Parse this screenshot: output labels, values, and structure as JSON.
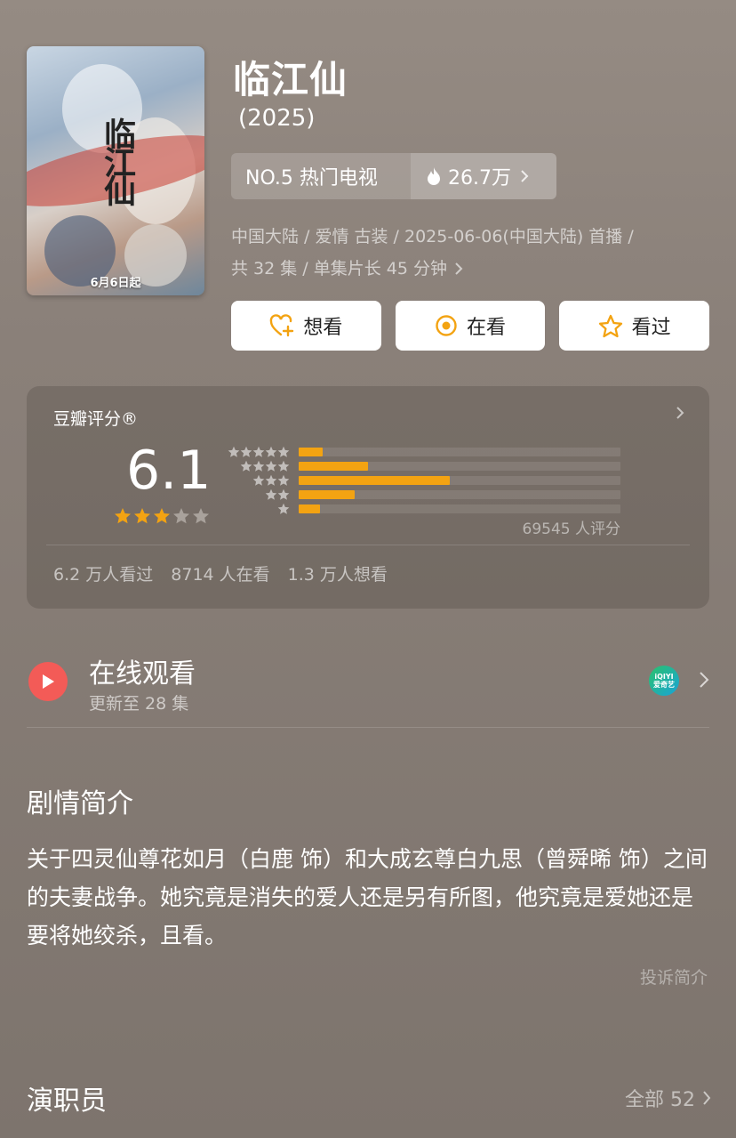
{
  "poster": {
    "title_art": "临江仙",
    "date_text": "6月6日起"
  },
  "show": {
    "title": "临江仙",
    "year": "(2025)"
  },
  "rank": {
    "label": "NO.5 热门电视",
    "heat": "26.7万"
  },
  "meta": {
    "line1": "中国大陆 / 爱情 古装 / 2025-06-06(中国大陆) 首播 /",
    "line2": "共 32 集 / 单集片长 45 分钟"
  },
  "actions": [
    {
      "label": "想看",
      "icon": "heart-plus-icon"
    },
    {
      "label": "在看",
      "icon": "target-icon"
    },
    {
      "label": "看过",
      "icon": "star-outline-icon"
    }
  ],
  "rating": {
    "label": "豆瓣评分®",
    "score": "6.1",
    "stars_filled": 3,
    "stars_total": 5,
    "distribution": [
      {
        "stars": 5,
        "percent": 7.5
      },
      {
        "stars": 4,
        "percent": 21.5
      },
      {
        "stars": 3,
        "percent": 47
      },
      {
        "stars": 2,
        "percent": 17.5
      },
      {
        "stars": 1,
        "percent": 6.5
      }
    ],
    "total": "69545 人评分",
    "watched": "6.2 万人看过",
    "watching": "8714 人在看",
    "want": "1.3 万人想看"
  },
  "watch": {
    "title": "在线观看",
    "subtitle": "更新至 28 集",
    "provider": "iQIYI 爱奇艺"
  },
  "synopsis": {
    "heading": "剧情简介",
    "text": "关于四灵仙尊花如月（白鹿 饰）和大成玄尊白九思（曾舜晞 饰）之间的夫妻战争。她究竟是消失的爱人还是另有所图，他究竟是爱她还是要将她绞杀，且看。",
    "complain": "投诉简介"
  },
  "cast": {
    "heading": "演职员",
    "all_label": "全部 52"
  },
  "colors": {
    "accent_orange": "#f3a312",
    "play_red": "#f35b57",
    "star_gray": "#a9a29c"
  }
}
